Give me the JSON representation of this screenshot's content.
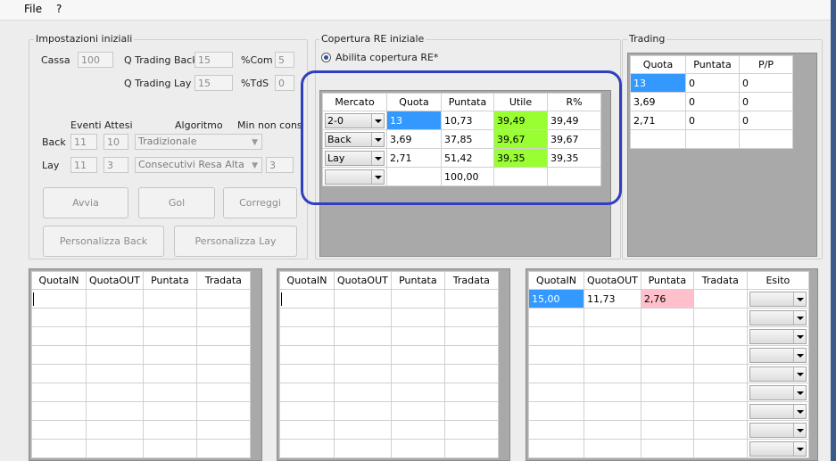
{
  "menu": {
    "file": "File",
    "help": "?"
  },
  "impostazioni": {
    "title": "Impostazioni iniziali",
    "cassa_label": "Cassa",
    "cassa_value": "100",
    "qtb_label": "Q Trading Back",
    "qtb_value": "15",
    "com_label": "%Com",
    "com_value": "5",
    "qtl_label": "Q Trading Lay",
    "qtl_value": "15",
    "tds_label": "%TdS",
    "tds_value": "0",
    "col_eventi": "Eventi",
    "col_attesi": "Attesi",
    "col_algoritmo": "Algoritmo",
    "col_minnoncons": "Min non cons",
    "back_label": "Back",
    "back_eventi": "11",
    "back_attesi": "10",
    "back_algoritmo": "Tradizionale",
    "lay_label": "Lay",
    "lay_eventi": "11",
    "lay_attesi": "3",
    "lay_algoritmo": "Consecutivi Resa Alta",
    "lay_minnoncons": "3",
    "btn_avvia": "Avvia",
    "btn_gol": "Gol",
    "btn_correggi": "Correggi",
    "btn_pers_back": "Personalizza Back",
    "btn_pers_lay": "Personalizza Lay"
  },
  "copertura": {
    "title": "Copertura RE iniziale",
    "radio_label": "Abilita copertura RE*",
    "headers": [
      "Mercato",
      "Quota",
      "Puntata",
      "Utile",
      "R%"
    ],
    "rows": [
      {
        "mercato": "2-0",
        "quota": "13",
        "puntata": "10,73",
        "utile": "39,49",
        "r": "39,49"
      },
      {
        "mercato": "Back",
        "quota": "3,69",
        "puntata": "37,85",
        "utile": "39,67",
        "r": "39,67"
      },
      {
        "mercato": "Lay",
        "quota": "2,71",
        "puntata": "51,42",
        "utile": "39,35",
        "r": "39,35"
      },
      {
        "mercato": "",
        "quota": "",
        "puntata": "100,00",
        "utile": "",
        "r": ""
      }
    ]
  },
  "trading": {
    "title": "Trading",
    "headers": [
      "Quota",
      "Puntata",
      "P/P"
    ],
    "rows": [
      {
        "quota": "13",
        "puntata": "0",
        "pp": "0"
      },
      {
        "quota": "3,69",
        "puntata": "0",
        "pp": "0"
      },
      {
        "quota": "2,71",
        "puntata": "0",
        "pp": "0"
      }
    ]
  },
  "grid_left": {
    "headers": [
      "QuotaIN",
      "QuotaOUT",
      "Puntata",
      "Tradata"
    ]
  },
  "grid_mid": {
    "headers": [
      "QuotaIN",
      "QuotaOUT",
      "Puntata",
      "Tradata"
    ]
  },
  "grid_right": {
    "headers": [
      "QuotaIN",
      "QuotaOUT",
      "Puntata",
      "Tradata",
      "Esito"
    ],
    "first_row": {
      "quota_in": "15,00",
      "quota_out": "11,73",
      "puntata": "2,76",
      "tradata": ""
    }
  },
  "colors": {
    "selection": "#3399ff",
    "profit_green": "#99ff33",
    "stake_pink": "#ffc0cb",
    "highlight_ring": "#2f3fbf"
  }
}
